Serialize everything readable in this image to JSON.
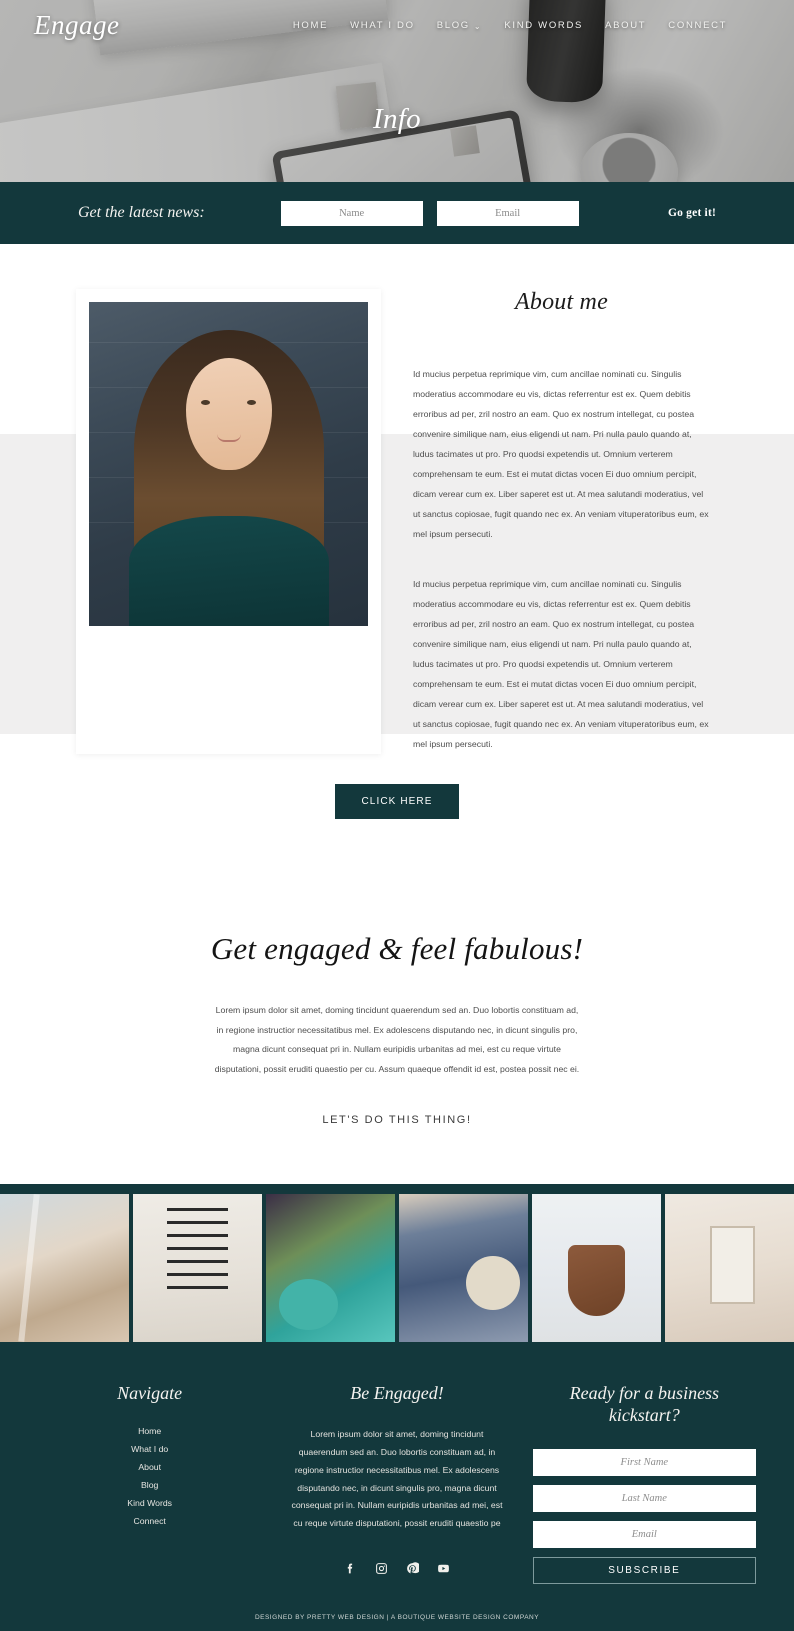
{
  "colors": {
    "teal": "#13383c",
    "gray_band": "#f0efef",
    "white": "#ffffff",
    "body_text": "#4e4e4e"
  },
  "header": {
    "brand": "Engage",
    "nav": [
      {
        "label": "HOME",
        "has_dropdown": false
      },
      {
        "label": "WHAT I DO",
        "has_dropdown": false
      },
      {
        "label": "BLOG",
        "has_dropdown": true,
        "chevron": "⌄"
      },
      {
        "label": "KIND WORDS",
        "has_dropdown": false
      },
      {
        "label": "ABOUT",
        "has_dropdown": false
      },
      {
        "label": "CONNECT",
        "has_dropdown": false
      }
    ],
    "hero_title": "Info"
  },
  "newsletter": {
    "label": "Get the latest news:",
    "name_placeholder": "Name",
    "name_value": "",
    "email_placeholder": "Email",
    "email_value": "",
    "button": "Go get it!"
  },
  "about": {
    "title": "About me",
    "paragraph1": "Id mucius perpetua reprimique vim, cum ancillae nominati cu. Singulis moderatius accommodare eu vis, dictas referrentur est ex. Quem debitis erroribus ad per, zril nostro an eam. Quo ex nostrum intellegat, cu postea convenire similique nam, eius eligendi ut nam. Pri nulla paulo quando at, ludus tacimates ut pro. Pro quodsi expetendis ut. Omnium verterem comprehensam te eum. Est ei mutat dictas vocen Ei duo omnium percipit, dicam verear cum ex. Liber saperet est ut. At mea salutandi moderatius, vel ut sanctus copiosae, fugit quando nec ex. An veniam vituperatoribus eum, ex mel ipsum persecuti.",
    "paragraph2": "Id mucius perpetua reprimique vim, cum ancillae nominati cu. Singulis moderatius accommodare eu vis, dictas referrentur est ex. Quem debitis erroribus ad per, zril nostro an eam. Quo ex nostrum intellegat, cu postea convenire similique nam, eius eligendi ut nam. Pri nulla paulo quando at, ludus tacimates ut pro. Pro quodsi expetendis ut. Omnium verterem comprehensam te eum. Est ei mutat dictas vocen Ei duo omnium percipit, dicam verear cum ex. Liber saperet est ut. At mea salutandi moderatius, vel ut sanctus copiosae, fugit quando nec ex. An veniam vituperatoribus eum, ex mel ipsum persecuti.",
    "button": "CLICK HERE",
    "portrait_alt": "woman-portrait-photo"
  },
  "engaged": {
    "title": "Get engaged & feel fabulous!",
    "paragraph": "Lorem ipsum dolor sit amet, doming tincidunt quaerendum sed an. Duo lobortis constituam ad, in regione instructior necessitatibus mel. Ex adolescens disputando nec, in dicunt singulis pro, magna dicunt consequat pri in. Nullam euripidis urbanitas ad mei, est cu reque virtute disputationi, possit eruditi quaestio per cu. Assum quaeque offendit id est, postea possit nec ei.",
    "cta": "LET'S DO THIS THING!"
  },
  "gallery": {
    "items": [
      {
        "name": "feathers-dreamcatcher-photo"
      },
      {
        "name": "macrame-wall-hanging-photo"
      },
      {
        "name": "cafe-table-plants-photo"
      },
      {
        "name": "woman-skirt-round-bag-photo"
      },
      {
        "name": "child-with-guitar-photo"
      },
      {
        "name": "boho-bedroom-decor-photo"
      }
    ]
  },
  "footer": {
    "navigate": {
      "title": "Navigate",
      "items": [
        {
          "label": "Home"
        },
        {
          "label": "What I do"
        },
        {
          "label": "About"
        },
        {
          "label": "Blog"
        },
        {
          "label": "Kind Words"
        },
        {
          "label": "Connect"
        }
      ]
    },
    "engaged": {
      "title": "Be Engaged!",
      "paragraph": "Lorem ipsum dolor sit amet, doming tincidunt quaerendum sed an. Duo lobortis constituam ad, in regione instructior necessitatibus mel. Ex adolescens disputando nec, in dicunt singulis pro, magna dicunt consequat pri in. Nullam euripidis urbanitas ad mei, est cu reque virtute disputationi, possit eruditi quaestio pe",
      "socials": [
        {
          "name": "facebook-icon"
        },
        {
          "name": "instagram-icon"
        },
        {
          "name": "pinterest-icon"
        },
        {
          "name": "youtube-icon"
        }
      ]
    },
    "subscribe": {
      "title": "Ready for a business kickstart?",
      "first_name_placeholder": "First Name",
      "first_name_value": "",
      "last_name_placeholder": "Last Name",
      "last_name_value": "",
      "email_placeholder": "Email",
      "email_value": "",
      "button": "SUBSCRIBE"
    },
    "credit": "DESIGNED BY PRETTY WEB DESIGN | A BOUTIQUE WEBSITE DESIGN COMPANY"
  }
}
